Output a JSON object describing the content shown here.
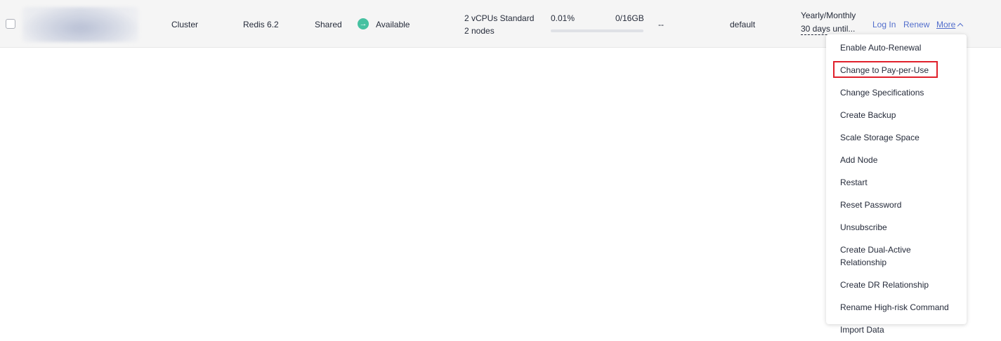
{
  "row": {
    "type": "Cluster",
    "version": "Redis 6.2",
    "spec_type": "Shared",
    "status": "Available",
    "spec_line1": "2 vCPUs Standard",
    "spec_line2": "2 nodes",
    "usage_percent": "0.01%",
    "usage_capacity": "0/16GB",
    "usage_fraction": 0.01,
    "placeholder": "--",
    "enterprise_project": "default",
    "billing_mode": "Yearly/Monthly",
    "billing_expiry": "30 days until...",
    "actions": {
      "login": "Log In",
      "renew": "Renew",
      "more": "More"
    }
  },
  "dropdown": {
    "items": [
      "Enable Auto-Renewal",
      "Change to Pay-per-Use",
      "Change Specifications",
      "Create Backup",
      "Scale Storage Space",
      "Add Node",
      "Restart",
      "Reset Password",
      "Unsubscribe",
      "Create Dual-Active Relationship",
      "Create DR Relationship",
      "Rename High-risk Command",
      "Import Data"
    ],
    "highlighted_index": 1
  },
  "colors": {
    "status_available": "#46c1a1",
    "link": "#526ecc",
    "highlight_border": "#e0202b"
  }
}
